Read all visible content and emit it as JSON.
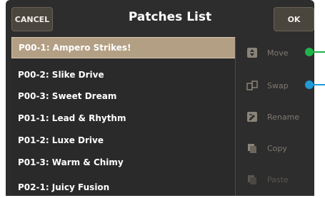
{
  "header": {
    "cancel_label": "CANCEL",
    "title": "Patches List",
    "ok_label": "OK"
  },
  "patches": [
    {
      "label": "P00-1: Ampero Strikes!",
      "selected": true
    },
    {
      "label": "P00-2: Slike Drive",
      "selected": false
    },
    {
      "label": "P00-3: Sweet Dream",
      "selected": false
    },
    {
      "label": "P01-1: Lead & Rhythm",
      "selected": false
    },
    {
      "label": "P01-2: Luxe Drive",
      "selected": false
    },
    {
      "label": "P01-3: Warm & Chimy",
      "selected": false
    },
    {
      "label": "P02-1: Juicy Fusion",
      "selected": false
    }
  ],
  "actions": [
    {
      "label": "Move",
      "icon": "move-icon",
      "enabled": true
    },
    {
      "label": "Swap",
      "icon": "swap-icon",
      "enabled": true
    },
    {
      "label": "Rename",
      "icon": "rename-icon",
      "enabled": true
    },
    {
      "label": "Copy",
      "icon": "copy-icon",
      "enabled": true
    },
    {
      "label": "Paste",
      "icon": "paste-icon",
      "enabled": false
    }
  ],
  "colors": {
    "selected_row": "#b39f84",
    "move_callout": "#1fb24a",
    "swap_callout": "#1e9ad6"
  }
}
